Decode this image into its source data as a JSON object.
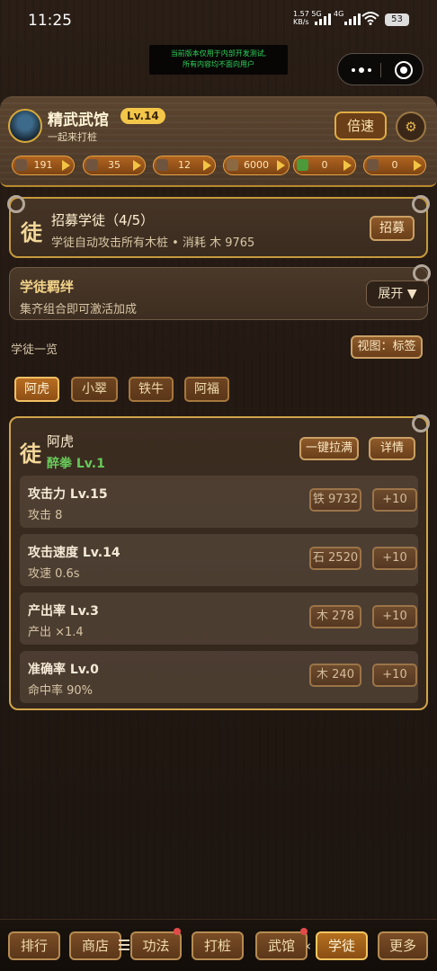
{
  "status_bar": {
    "time": "11:25",
    "net_speed": "1.57",
    "net_unit": "KB/s",
    "net_type_1": "5G",
    "net_type_2": "4G",
    "battery": "53"
  },
  "dev_notice": {
    "line1": "当前版本仅用于内部开发测试,",
    "line2": "所有内容均不面向用户"
  },
  "header": {
    "gym_name": "精武武馆",
    "level": "Lv.14",
    "subtitle": "一起来打桩",
    "speed_label": "倍速",
    "resources": [
      {
        "icon": "coin-icon",
        "value": "191"
      },
      {
        "icon": "iron-icon",
        "value": "35"
      },
      {
        "icon": "stone-icon",
        "value": "12"
      },
      {
        "icon": "wood-icon",
        "value": "6000"
      },
      {
        "icon": "herb-icon",
        "value": "0"
      },
      {
        "icon": "log-icon",
        "value": "0"
      }
    ]
  },
  "recruit": {
    "char": "徒",
    "title": "招募学徒（4/5）",
    "desc": "学徒自动攻击所有木桩 • 消耗 木 9765",
    "button": "招募"
  },
  "bond": {
    "title": "学徒羁绊",
    "desc": "集齐组合即可激活加成",
    "button": "展开 ▼"
  },
  "disciples": {
    "section_label": "学徒一览",
    "view_button": "视图：标签",
    "tabs": [
      "阿虎",
      "小翠",
      "铁牛",
      "阿福"
    ],
    "active_tab": "阿虎"
  },
  "detail": {
    "char": "徒",
    "name": "阿虎",
    "skill": "醉拳 Lv.1",
    "max_button": "一键拉满",
    "info_button": "详情",
    "stats": [
      {
        "name": "攻击力 Lv.15",
        "value": "攻击 8",
        "cost": "铁 9732",
        "plus": "+10"
      },
      {
        "name": "攻击速度 Lv.14",
        "value": "攻速 0.6s",
        "cost": "石 2520",
        "plus": "+10"
      },
      {
        "name": "产出率 Lv.3",
        "value": "产出 ×1.4",
        "cost": "木 278",
        "plus": "+10"
      },
      {
        "name": "准确率 Lv.0",
        "value": "命中率 90%",
        "cost": "木 240",
        "plus": "+10"
      }
    ]
  },
  "bottom_nav": {
    "items": [
      "排行",
      "商店",
      "功法",
      "打桩",
      "武馆",
      "学徒",
      "更多"
    ],
    "active": "学徒"
  }
}
